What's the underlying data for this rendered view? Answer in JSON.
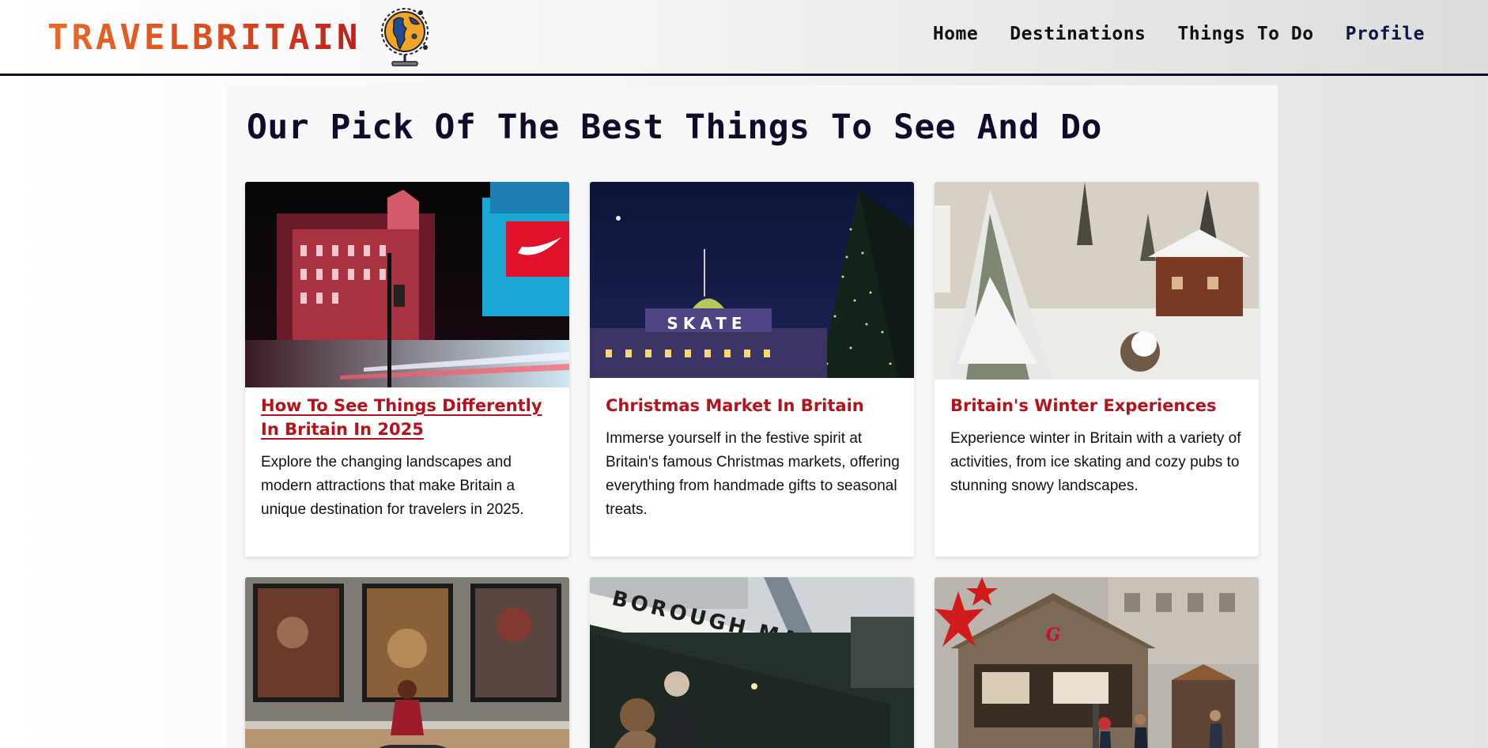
{
  "header": {
    "logo_text": "TRAVELBRITAIN",
    "logo_icon": "globe-icon",
    "nav": [
      {
        "label": "Home"
      },
      {
        "label": "Destinations"
      },
      {
        "label": "Things To Do"
      },
      {
        "label": "Profile"
      }
    ]
  },
  "main": {
    "title": "Our Pick Of The Best Things To See And Do",
    "cards": [
      {
        "title": "How To See Things Differently In Britain In 2025",
        "description": "Explore the changing landscapes and modern attractions that make Britain a unique destination for travelers in 2025.",
        "image": "piccadilly-circus-night-photo"
      },
      {
        "title": "Christmas Market In Britain",
        "description": "Immerse yourself in the festive spirit at Britain's famous Christmas markets, offering everything from handmade gifts to seasonal treats.",
        "image": "skate-rink-christmas-tree-photo",
        "image_text": "SKATE"
      },
      {
        "title": "Britain's Winter Experiences",
        "description": "Experience winter in Britain with a variety of activities, from ice skating and cozy pubs to stunning snowy landscapes.",
        "image": "snowy-cabin-landscape-photo"
      },
      {
        "image": "art-gallery-paintings-photo"
      },
      {
        "image": "borough-market-entrance-photo",
        "image_text": "BOROUGH MARKET"
      },
      {
        "image": "christmas-market-stalls-photo"
      }
    ]
  },
  "colors": {
    "title_navy": "#0d0d2b",
    "card_title_red": "#b5121b",
    "logo_orange": "#e86a25"
  }
}
